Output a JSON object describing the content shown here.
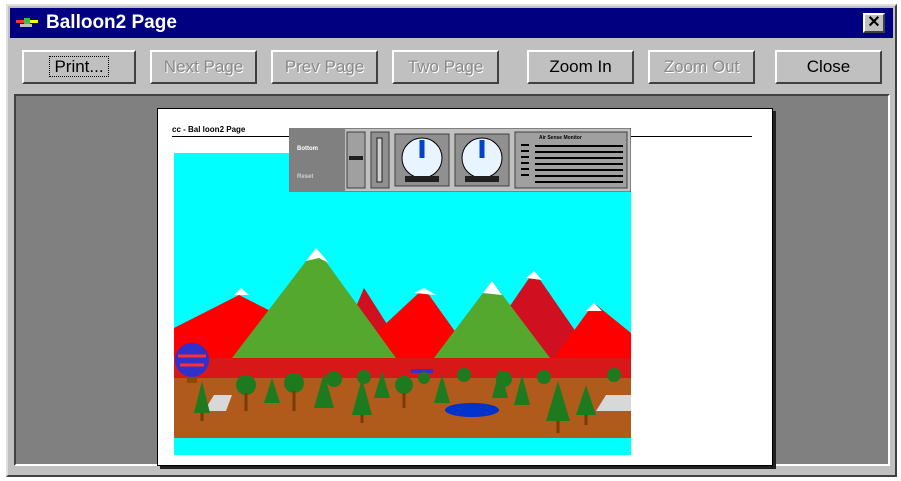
{
  "window": {
    "title": "Balloon2 Page",
    "close_glyph": "✕"
  },
  "toolbar": {
    "print": "Print...",
    "next_page": "Next Page",
    "prev_page": "Prev Page",
    "two_page": "Two Page",
    "zoom_in": "Zoom In",
    "zoom_out": "Zoom Out",
    "close": "Close"
  },
  "page": {
    "header": "cc - Bal loon2 Page",
    "panel": {
      "label_top": "Bottom",
      "label_bottom": "Reset",
      "graph_title": "Air Sense Monitor"
    }
  },
  "colors": {
    "title_bar": "#000080",
    "chrome": "#c0c0c0",
    "sky": "#00ffff",
    "mountain_red": "#ff0000",
    "mountain_green": "#55a82e",
    "ground": "#b05a1c",
    "lake": "#0033cc"
  }
}
